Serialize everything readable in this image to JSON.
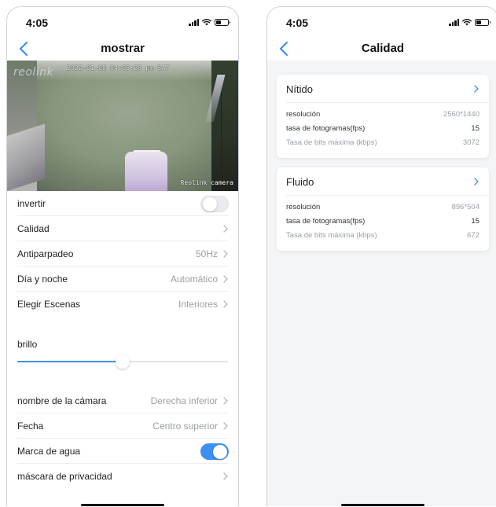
{
  "status_bar": {
    "time": "4:05"
  },
  "left_screen": {
    "title": "mostrar",
    "camera": {
      "logo": "reolink",
      "timestamp": "2022-01-08 04:05:29 pm SAT",
      "camera_name": "Reolink camera"
    },
    "settings": {
      "invert": {
        "label": "invertir",
        "enabled": false
      },
      "quality": {
        "label": "Calidad",
        "value": ""
      },
      "antiflicker": {
        "label": "Antiparpadeo",
        "value": "50Hz"
      },
      "day_night": {
        "label": "Día y noche",
        "value": "Automático"
      },
      "scenes": {
        "label": "Elegir Escenas",
        "value": "Interiores"
      },
      "brightness": {
        "label": "brillo",
        "level_fraction": 0.5
      },
      "camera_name": {
        "label": "nombre de la cámara",
        "value": "Derecha inferior"
      },
      "date": {
        "label": "Fecha",
        "value": "Centro superior"
      },
      "watermark": {
        "label": "Marca de agua",
        "enabled": true
      },
      "privacy_mask": {
        "label": "máscara de privacidad",
        "value": ""
      }
    }
  },
  "right_screen": {
    "title": "Calidad",
    "profiles": [
      {
        "name": "Nítido",
        "specs": [
          {
            "label": "resolución",
            "value": "2560*1440",
            "dim": false
          },
          {
            "label": "tasa de fotogramas(fps)",
            "value": "15",
            "dim": false
          },
          {
            "label": "Tasa de bits máxima (kbps)",
            "value": "3072",
            "dim": true
          }
        ]
      },
      {
        "name": "Fluido",
        "specs": [
          {
            "label": "resolución",
            "value": "896*504",
            "dim": false
          },
          {
            "label": "tasa de fotogramas(fps)",
            "value": "15",
            "dim": false
          },
          {
            "label": "Tasa de bits máxima (kbps)",
            "value": "672",
            "dim": true
          }
        ]
      }
    ]
  },
  "colors": {
    "accent": "#3d8ff0",
    "divider": "#eceef0",
    "muted_text": "#9aa0a6"
  },
  "icons": {
    "back": "chevron-left-icon",
    "row_arrow": "chevron-right-icon"
  }
}
